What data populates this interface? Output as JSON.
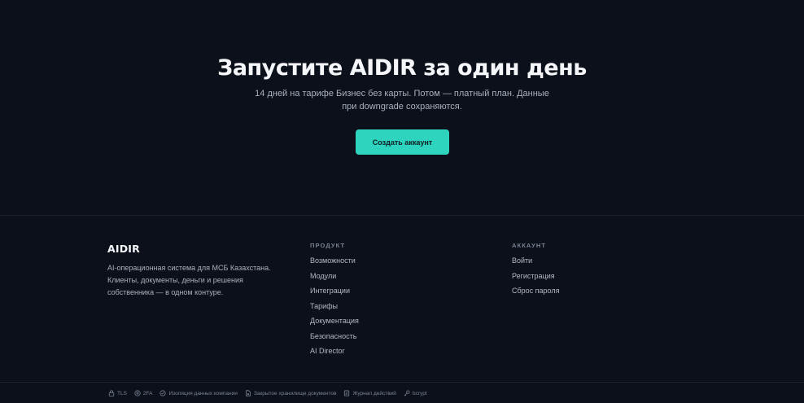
{
  "cta": {
    "title": "Запустите AIDIR за один день",
    "subtitle": "14 дней на тарифе Бизнес без карты. Потом — платный план. Данные при downgrade сохраняются.",
    "button_label": "Создать аккаунт"
  },
  "footer": {
    "brand": {
      "logo": "AIDIR",
      "description": "AI-операционная система для МСБ Казахстана. Клиенты, документы, деньги и решения собственника — в одном контуре."
    },
    "product": {
      "heading": "ПРОДУКТ",
      "links": [
        "Возможности",
        "Модули",
        "Интеграции",
        "Тарифы",
        "Документация",
        "Безопасность",
        "AI Director"
      ]
    },
    "account": {
      "heading": "АККАУНТ",
      "links": [
        "Войти",
        "Регистрация",
        "Сброс пароля"
      ]
    }
  },
  "trust_bar": [
    {
      "icon": "lock-icon",
      "label": "TLS"
    },
    {
      "icon": "shield-icon",
      "label": "2FA"
    },
    {
      "icon": "check-circle-icon",
      "label": "Изоляция данных компании"
    },
    {
      "icon": "file-lock-icon",
      "label": "Закрытое хранилище документов"
    },
    {
      "icon": "journal-icon",
      "label": "Журнал действий"
    },
    {
      "icon": "key-icon",
      "label": "bcrypt"
    }
  ],
  "colors": {
    "background": "#0b101b",
    "accent": "#2fd4bf",
    "heading": "#f4f6fa",
    "muted": "#aab0bd"
  }
}
